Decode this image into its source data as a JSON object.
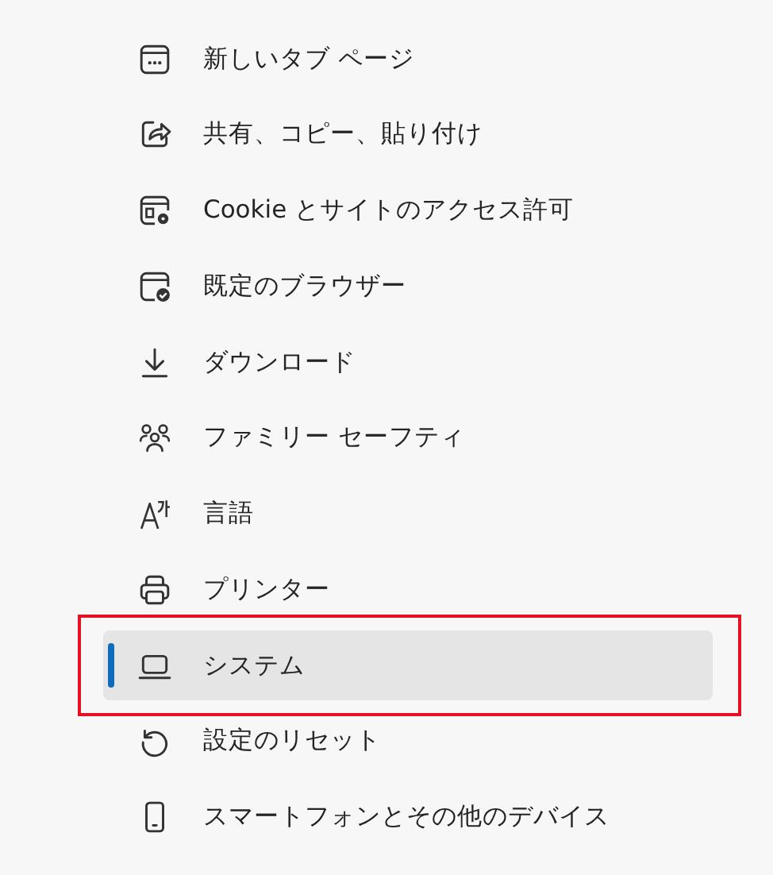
{
  "sidebar": {
    "items": [
      {
        "label": "新しいタブ ページ",
        "selected": false,
        "annotated": false
      },
      {
        "label": "共有、コピー、貼り付け",
        "selected": false,
        "annotated": false
      },
      {
        "label": "Cookie とサイトのアクセス許可",
        "selected": false,
        "annotated": false
      },
      {
        "label": "既定のブラウザー",
        "selected": false,
        "annotated": false
      },
      {
        "label": "ダウンロード",
        "selected": false,
        "annotated": false
      },
      {
        "label": "ファミリー セーフティ",
        "selected": false,
        "annotated": false
      },
      {
        "label": "言語",
        "selected": false,
        "annotated": false
      },
      {
        "label": "プリンター",
        "selected": false,
        "annotated": false
      },
      {
        "label": "システム",
        "selected": true,
        "annotated": true
      },
      {
        "label": "設定のリセット",
        "selected": false,
        "annotated": false
      },
      {
        "label": "スマートフォンとその他のデバイス",
        "selected": false,
        "annotated": false
      }
    ]
  }
}
